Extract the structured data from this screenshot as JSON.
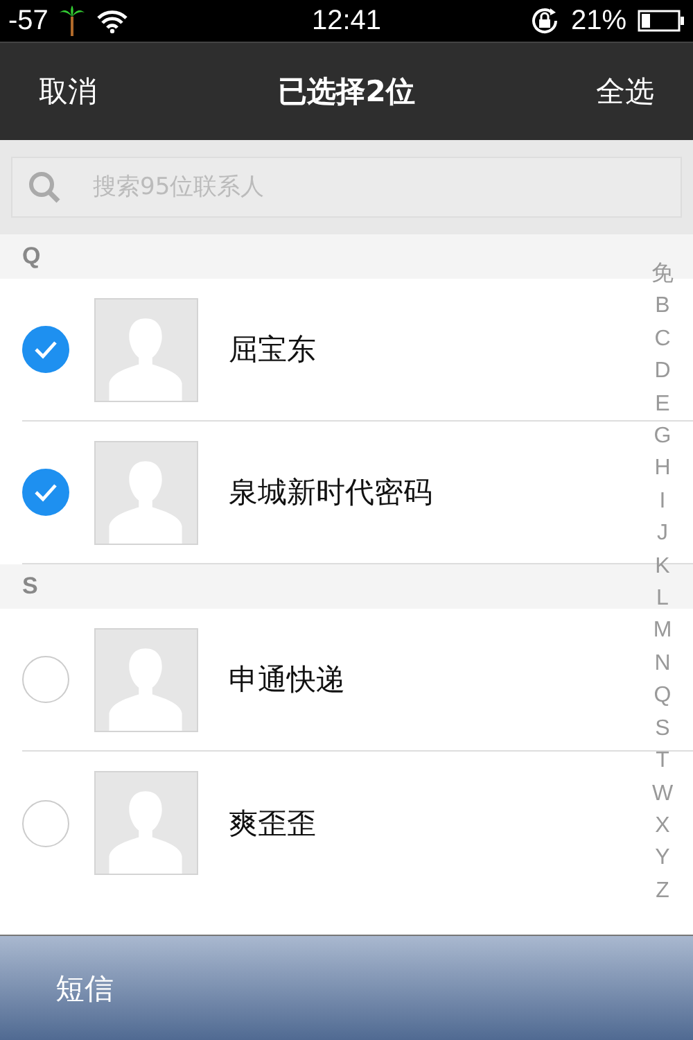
{
  "status_bar": {
    "signal": "-57",
    "time": "12:41",
    "battery": "21%"
  },
  "nav_bar": {
    "left": "取消",
    "title": "已选择2位",
    "right": "全选"
  },
  "search": {
    "placeholder": "搜索95位联系人"
  },
  "sections": [
    {
      "header": "Q",
      "contacts": [
        {
          "name": "屈宝东",
          "selected": true
        },
        {
          "name": "泉城新时代密码",
          "selected": true
        }
      ]
    },
    {
      "header": "S",
      "contacts": [
        {
          "name": "申通快递",
          "selected": false
        },
        {
          "name": "爽歪歪",
          "selected": false
        }
      ]
    }
  ],
  "index": [
    "免",
    "B",
    "C",
    "D",
    "E",
    "G",
    "H",
    "I",
    "J",
    "K",
    "L",
    "M",
    "N",
    "Q",
    "S",
    "T",
    "W",
    "X",
    "Y",
    "Z"
  ],
  "bottom_bar": {
    "left": "短信"
  }
}
